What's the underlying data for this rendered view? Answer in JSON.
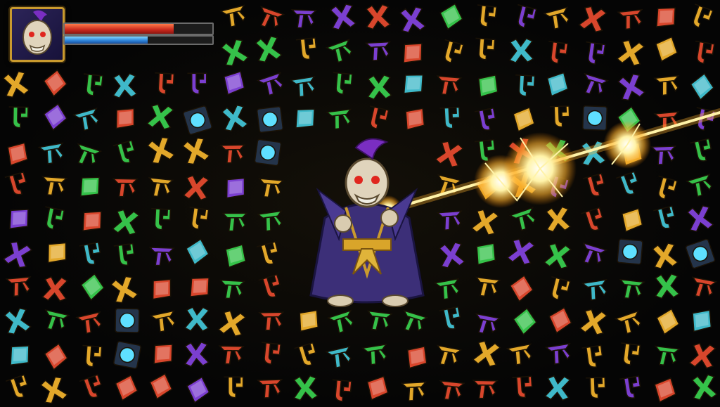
{
  "player": {
    "portrait": "skull-sorcerer-portrait",
    "health": 0.74,
    "mana": 0.56
  },
  "colors": {
    "gold": "#e3a82a",
    "green": "#35c24a",
    "red": "#d8462c",
    "purple": "#7b3fd0",
    "teal": "#3fb9c9",
    "beam": "#fff3a8",
    "health": "#c8281c",
    "mana": "#2a7fd6"
  },
  "icons": [
    "rune-branch-icon",
    "rune-hook-icon",
    "rune-gem-icon",
    "rune-cross-icon",
    "orb-icon",
    "chest-icon"
  ],
  "enemy": {
    "name_icon": "skull-sorcerer-icon",
    "spell": "lightning-beam-icon"
  }
}
